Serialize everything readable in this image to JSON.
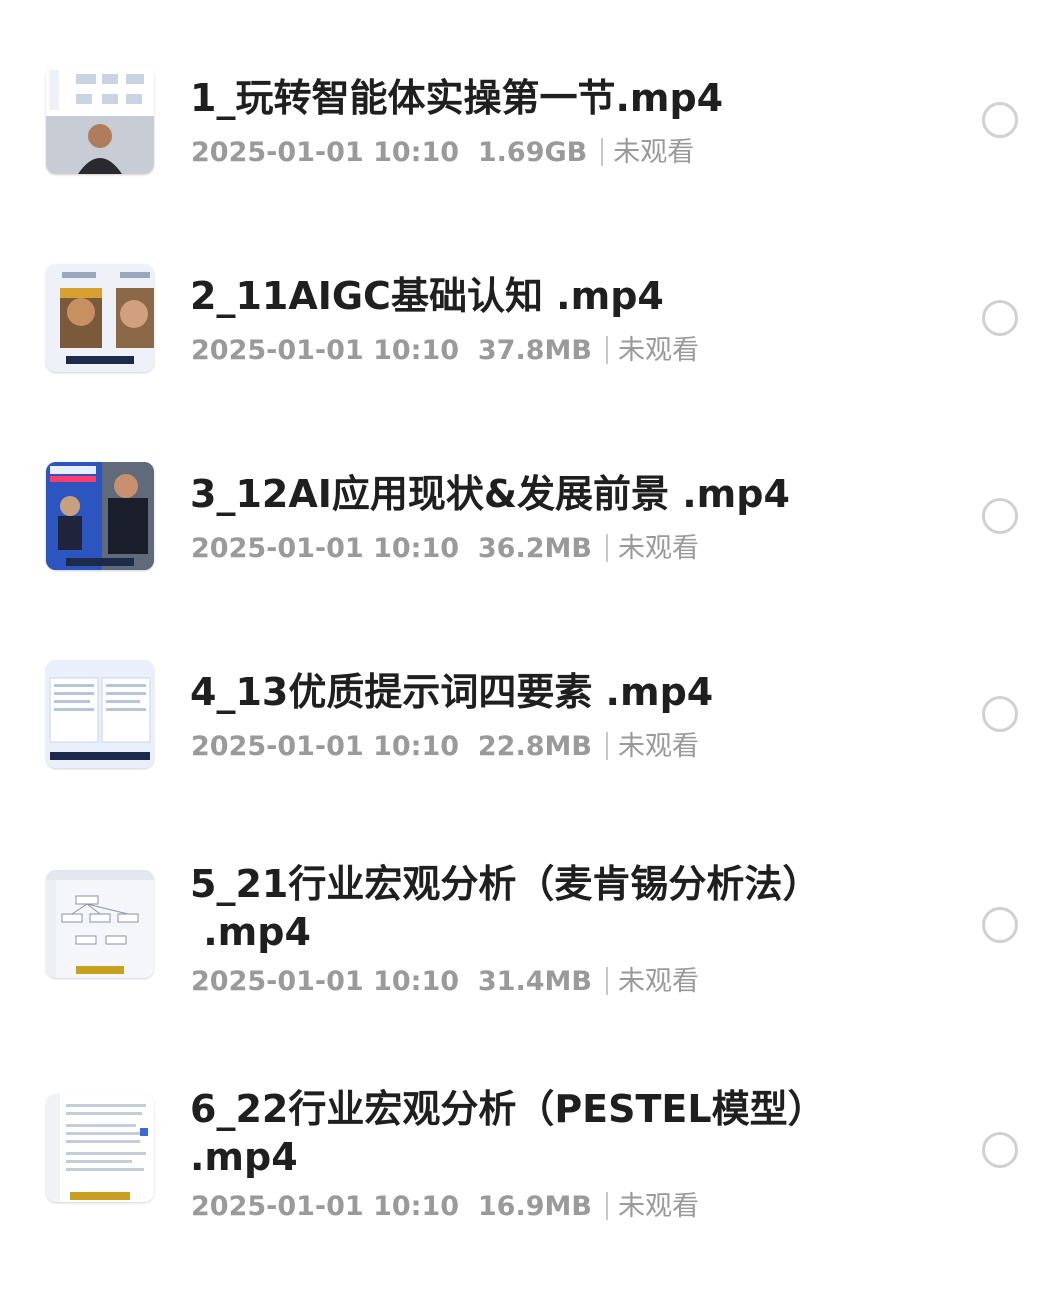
{
  "files": [
    {
      "name": "1_玩转智能体实操第一节.mp4",
      "date": "2025-01-01 10:10",
      "size": "1.69GB",
      "status": "未观看",
      "selected": false
    },
    {
      "name": "2_11AIGC基础认知 .mp4",
      "date": "2025-01-01 10:10",
      "size": "37.8MB",
      "status": "未观看",
      "selected": false
    },
    {
      "name": "3_12AI应用现状&发展前景 .mp4",
      "date": "2025-01-01 10:10",
      "size": "36.2MB",
      "status": "未观看",
      "selected": false
    },
    {
      "name": "4_13优质提示词四要素 .mp4",
      "date": "2025-01-01 10:10",
      "size": "22.8MB",
      "status": "未观看",
      "selected": false
    },
    {
      "name": "5_21行业宏观分析（麦肯锡分析法）\n .mp4",
      "date": "2025-01-01 10:10",
      "size": "31.4MB",
      "status": "未观看",
      "selected": false
    },
    {
      "name": "6_22行业宏观分析（PESTEL模型）\n.mp4",
      "date": "2025-01-01 10:10",
      "size": "16.9MB",
      "status": "未观看",
      "selected": false
    }
  ],
  "icons": {
    "radio": "radio-unchecked-icon"
  },
  "colors": {
    "title": "#1f1f1f",
    "meta": "#9a9a9a",
    "radio_border": "#d0d0d0"
  }
}
